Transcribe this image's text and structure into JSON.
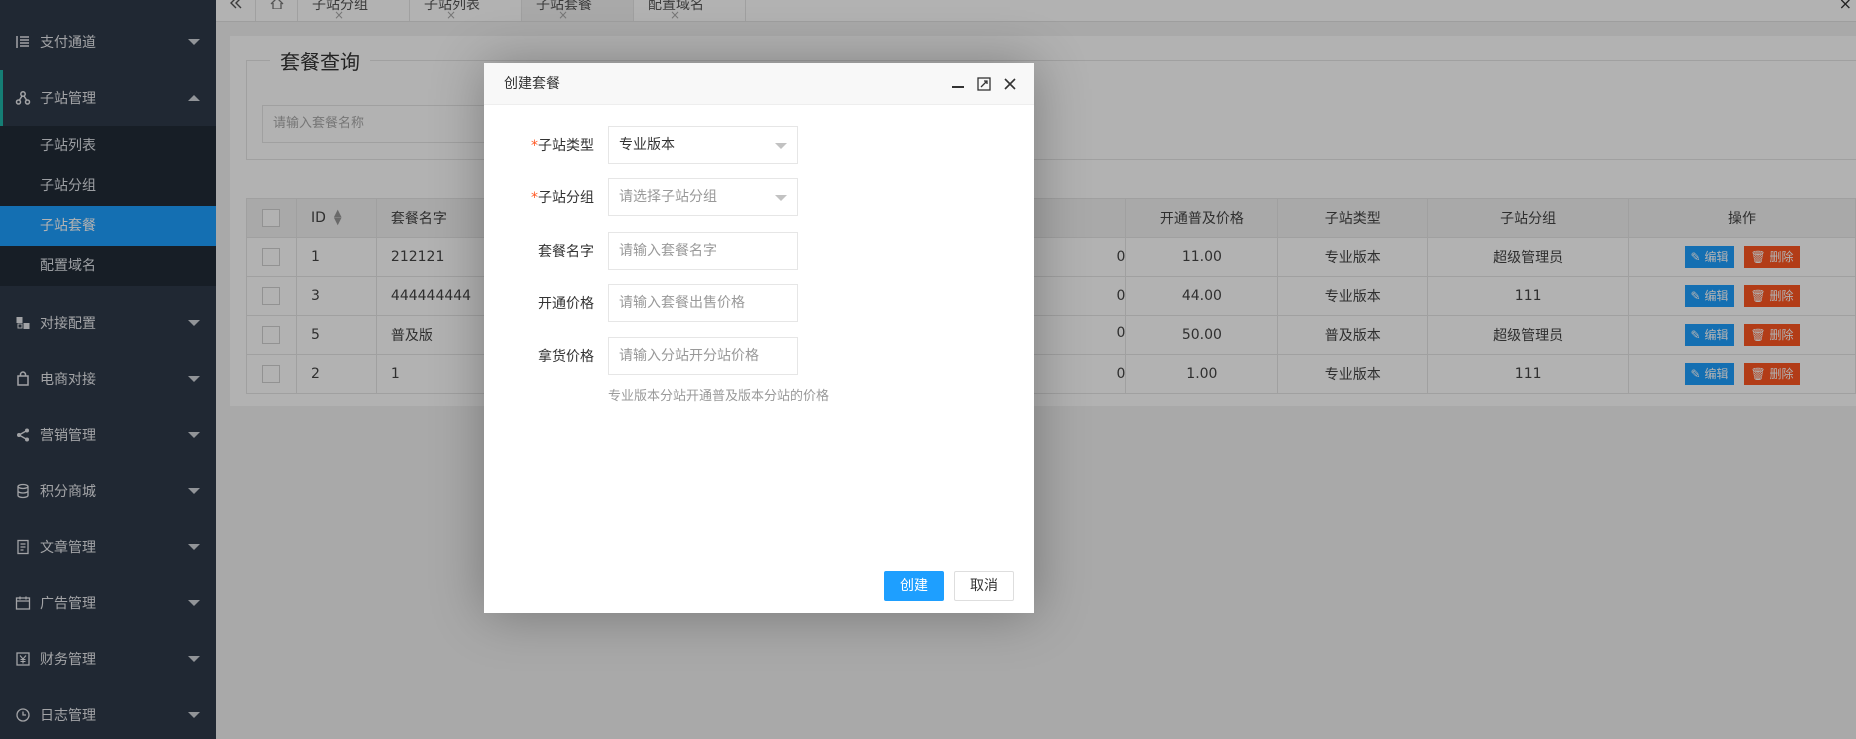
{
  "sidebar": {
    "items": [
      {
        "label": "支付通道",
        "icon": "list-icon"
      },
      {
        "label": "子站管理",
        "icon": "sitemap-icon",
        "expanded": true
      },
      {
        "label": "对接配置",
        "icon": "cubes-icon"
      },
      {
        "label": "电商对接",
        "icon": "bag-icon"
      },
      {
        "label": "营销管理",
        "icon": "share-icon"
      },
      {
        "label": "积分商城",
        "icon": "database-icon"
      },
      {
        "label": "文章管理",
        "icon": "document-icon"
      },
      {
        "label": "广告管理",
        "icon": "calendar-icon"
      },
      {
        "label": "财务管理",
        "icon": "yen-icon"
      },
      {
        "label": "日志管理",
        "icon": "clock-icon"
      }
    ],
    "sub_items": [
      "子站列表",
      "子站分组",
      "子站套餐",
      "配置域名"
    ],
    "active_sub": "子站套餐"
  },
  "tabs": {
    "collapse_icon": "double-chevron-left-icon",
    "home_icon": "home-icon",
    "items": [
      "子站分组",
      "子站列表",
      "子站套餐",
      "配置域名"
    ],
    "close_glyph": "×",
    "active": "子站套餐"
  },
  "query": {
    "legend": "套餐查询",
    "placeholder": "请输入套餐名称"
  },
  "table": {
    "headers": {
      "id": "ID",
      "name": "套餐名字",
      "open_basic_price": "开通普及价格",
      "type": "子站类型",
      "group": "子站分组",
      "ops": "操作"
    },
    "rows": [
      {
        "id": "1",
        "name": "212121",
        "hidden_tail": "0",
        "open_basic_price": "11.00",
        "type": "专业版本",
        "type_kind": "pro",
        "group": "超级管理员"
      },
      {
        "id": "3",
        "name": "444444444",
        "hidden_tail": "0",
        "open_basic_price": "44.00",
        "type": "专业版本",
        "type_kind": "pro",
        "group": "111"
      },
      {
        "id": "5",
        "name": "普及版",
        "hidden_tail": "0",
        "open_basic_price": "50.00",
        "type": "普及版本",
        "type_kind": "basic",
        "group": "超级管理员"
      },
      {
        "id": "2",
        "name": "1",
        "hidden_tail": "0",
        "open_basic_price": "1.00",
        "type": "专业版本",
        "type_kind": "pro",
        "group": "111"
      }
    ],
    "edit_label": "编辑",
    "delete_label": "删除"
  },
  "modal": {
    "title": "创建套餐",
    "fields": {
      "site_type": {
        "label": "子站类型",
        "value": "专业版本",
        "required": true
      },
      "site_group": {
        "label": "子站分组",
        "placeholder": "请选择子站分组",
        "required": true
      },
      "package_name": {
        "label": "套餐名字",
        "placeholder": "请输入套餐名字"
      },
      "open_price": {
        "label": "开通价格",
        "placeholder": "请输入套餐出售价格"
      },
      "supply_price": {
        "label": "拿货价格",
        "placeholder": "请输入分站开分站价格"
      }
    },
    "hint": "专业版本分站开通普及版本分站的价格",
    "create_label": "创建",
    "cancel_label": "取消",
    "required_mark": "*"
  },
  "colors": {
    "sidebar_bg": "#2f3a4a",
    "active_blue": "#1e9fff",
    "danger": "#ff5722",
    "pro_green": "#5fb878",
    "basic_red": "#ff2020"
  }
}
